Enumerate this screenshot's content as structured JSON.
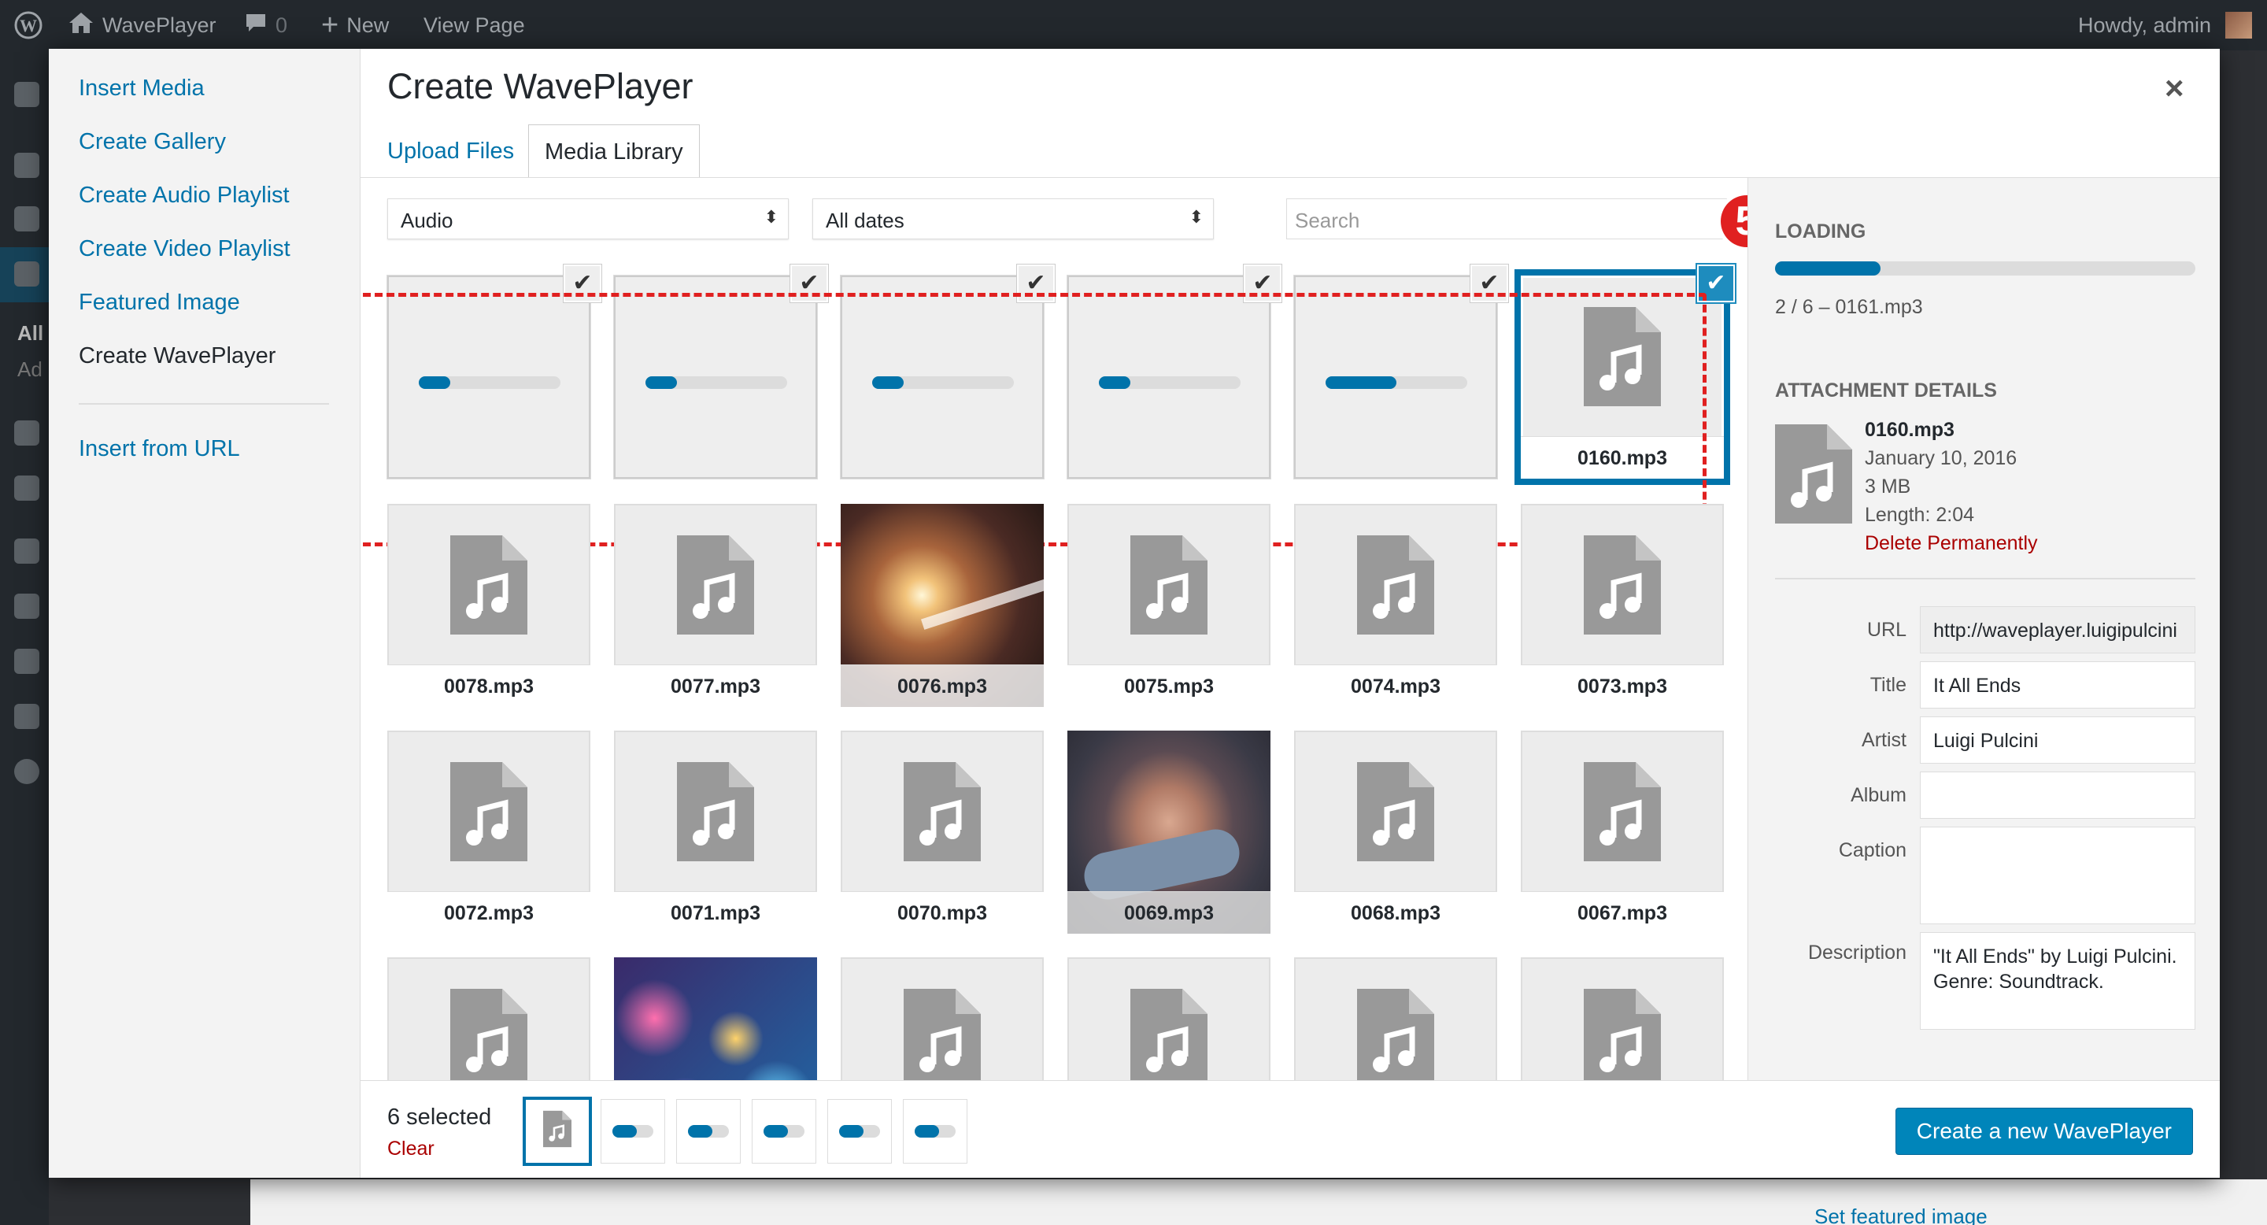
{
  "adminbar": {
    "site_name": "WavePlayer",
    "comments_count": "0",
    "new_label": "New",
    "view_page_label": "View Page",
    "howdy": "Howdy, admin"
  },
  "sidebar": {
    "partial_all": "All",
    "partial_add": "Ad"
  },
  "below": {
    "set_featured": "Set featured image"
  },
  "menu": {
    "items": [
      "Insert Media",
      "Create Gallery",
      "Create Audio Playlist",
      "Create Video Playlist",
      "Featured Image",
      "Create WavePlayer"
    ],
    "active": "Create WavePlayer",
    "insert_url": "Insert from URL"
  },
  "modal": {
    "title": "Create WavePlayer",
    "close_glyph": "×",
    "tabs": {
      "upload": "Upload Files",
      "library": "Media Library"
    }
  },
  "filters": {
    "type": "Audio",
    "dates": "All dates",
    "search_placeholder": "Search",
    "arrows": "⬍"
  },
  "annotation": {
    "step": "5"
  },
  "uploading": {
    "upload_progress": [
      0.22,
      0.22,
      0.22,
      0.22,
      0.5
    ],
    "selected_file": "0160.mp3",
    "check": "✔"
  },
  "grid": {
    "row2": [
      "0078.mp3",
      "0077.mp3",
      "0076.mp3",
      "0075.mp3",
      "0074.mp3",
      "0073.mp3"
    ],
    "row3": [
      "0072.mp3",
      "0071.mp3",
      "0070.mp3",
      "0069.mp3",
      "0068.mp3",
      "0067.mp3"
    ]
  },
  "side": {
    "uploading_heading": "LOADING",
    "upload_progress": 0.25,
    "upload_status": "2 / 6  –  0161.mp3",
    "attachment_heading": "ATTACHMENT DETAILS",
    "name": "0160.mp3",
    "date": "January 10, 2016",
    "size": "3 MB",
    "length": "Length: 2:04",
    "delete": "Delete Permanently",
    "fields": {
      "url_label": "URL",
      "url": "http://waveplayer.luigipulcini",
      "title_label": "Title",
      "title": "It All Ends",
      "artist_label": "Artist",
      "artist": "Luigi Pulcini",
      "album_label": "Album",
      "album": "",
      "caption_label": "Caption",
      "caption": "",
      "description_label": "Description",
      "description": "\"It All Ends\" by Luigi Pulcini. Genre: Soundtrack."
    }
  },
  "footer": {
    "selected": "6 selected",
    "clear": "Clear",
    "thumb_progress": [
      0.6,
      0.6,
      0.6,
      0.6,
      0.6
    ],
    "create_button": "Create a new WavePlayer"
  },
  "colors": {
    "accent": "#0073aa",
    "annotation": "#e02020",
    "danger": "#a00000"
  }
}
